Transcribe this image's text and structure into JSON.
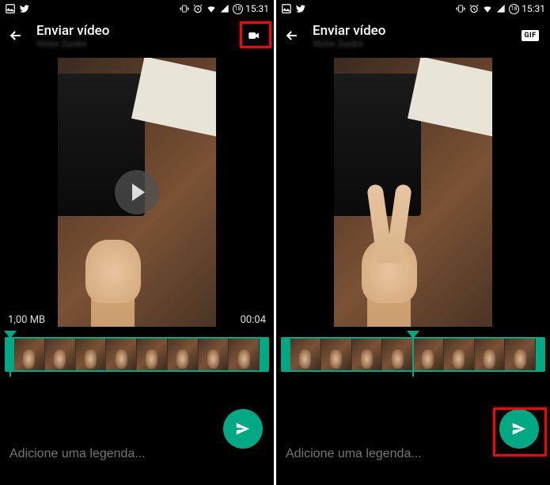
{
  "status_bar": {
    "time": "15:31",
    "battery_pct": "18"
  },
  "left": {
    "header": {
      "title": "Enviar vídeo",
      "subtitle": "Victor Zurdro",
      "mode_icon": "video-camera-icon"
    },
    "video": {
      "file_size": "1,00 MB",
      "duration": "00:04"
    },
    "caption_placeholder": "Adicione uma legenda..."
  },
  "right": {
    "header": {
      "title": "Enviar vídeo",
      "subtitle": "Victor Zurdro",
      "mode_label": "GIF"
    },
    "caption_placeholder": "Adicione uma legenda..."
  }
}
